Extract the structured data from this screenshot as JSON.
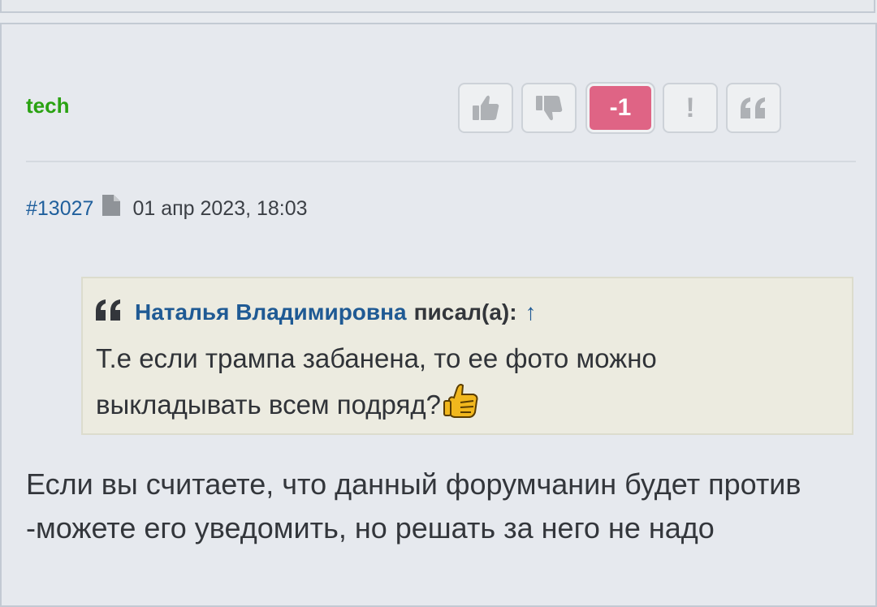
{
  "post": {
    "author": "tech",
    "score": "-1",
    "report_label": "!",
    "number": "#13027",
    "date": "01 апр 2023, 18:03",
    "quote": {
      "user": "Наталья Владимировна",
      "wrote": "писал(а):",
      "link": "↑",
      "text": "Т.е если трампа забанена, то ее фото можно выкладывать всем подряд?"
    },
    "body": "Если вы считаете, что данный форумчанин будет против -можете его уведомить, но решать за него не надо"
  },
  "icons": {
    "like": "thumbs-up-icon",
    "dislike": "thumbs-down-icon",
    "report": "exclamation-icon",
    "quote": "quote-icon",
    "document": "document-icon",
    "smiley": "thumbs-up-smiley"
  },
  "colors": {
    "author": "#2aa212",
    "score_bg": "#df6485",
    "link": "#1f5f9c",
    "quote_bg": "#ecebe0"
  }
}
